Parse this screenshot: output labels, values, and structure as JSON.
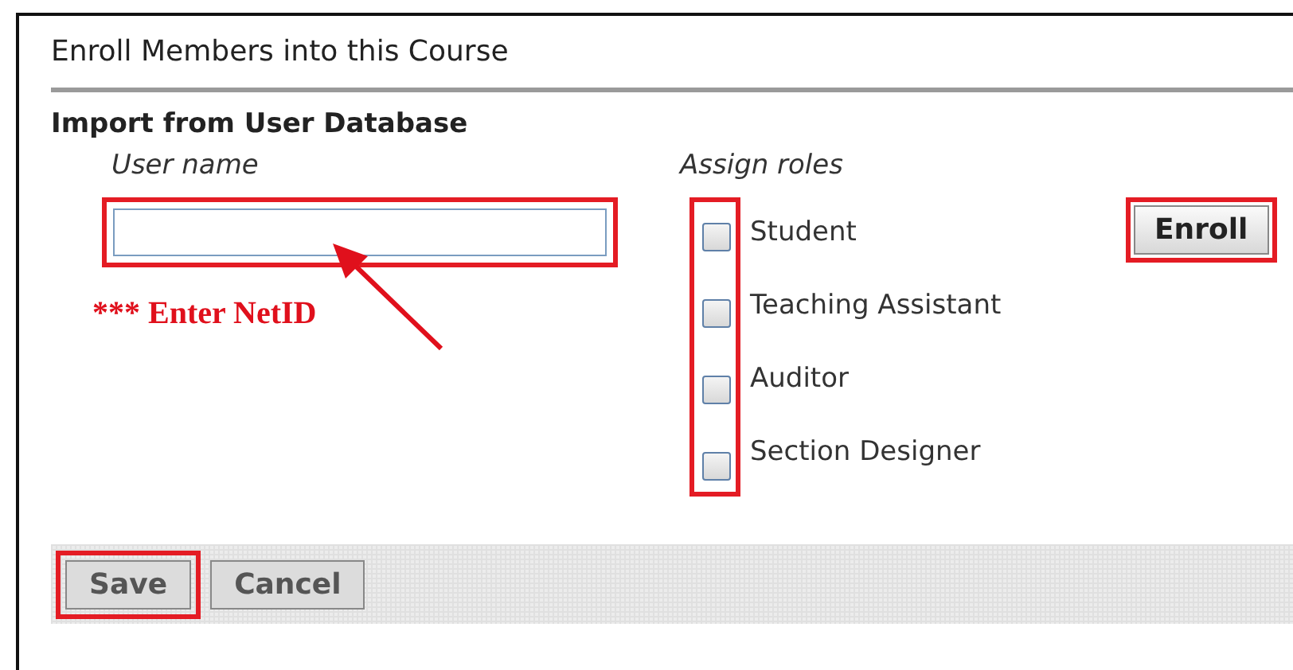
{
  "window": {
    "title": "Enroll Members into this Course"
  },
  "section": {
    "title": "Import from User Database"
  },
  "username": {
    "label": "User name"
  },
  "annotation": {
    "text": "*** Enter NetID"
  },
  "roles": {
    "label": "Assign roles",
    "items": [
      {
        "label": "Student",
        "checked": false
      },
      {
        "label": "Teaching Assistant",
        "checked": false
      },
      {
        "label": "Auditor",
        "checked": false
      },
      {
        "label": "Section Designer",
        "checked": false
      }
    ]
  },
  "enroll_button": "Enroll",
  "buttons": [
    {
      "label": "Save",
      "highlighted": true
    },
    {
      "label": "Cancel",
      "highlighted": false
    }
  ]
}
